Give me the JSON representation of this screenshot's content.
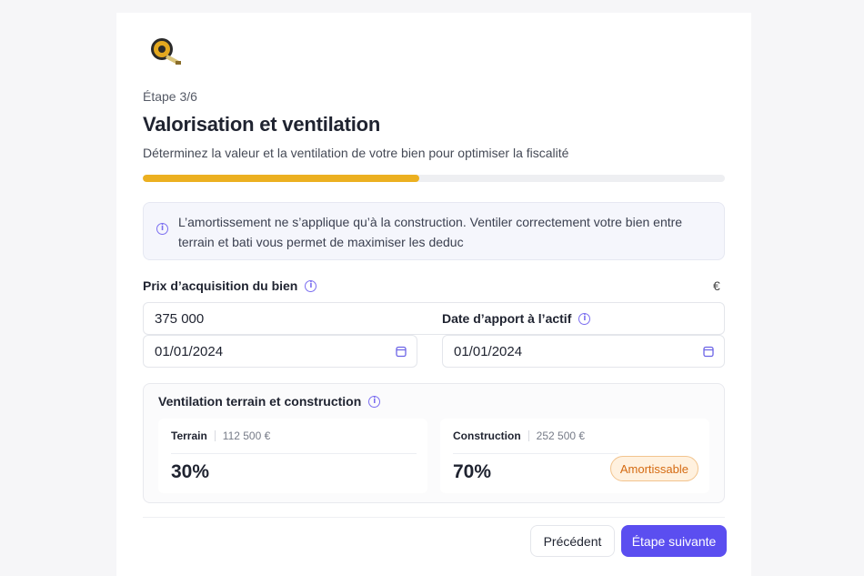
{
  "header": {
    "logo_icon": "tape-measure-icon",
    "step": "Étape 3/6",
    "title": "Valorisation et ventilation",
    "subtitle": "Déterminez la valeur et la ventilation de votre bien pour optimiser la fiscalité"
  },
  "progress": {
    "fraction": 0.475,
    "color": "#ecb020"
  },
  "info": {
    "text": "L’amortissement ne s’applique qu’à la construction. Ventiler correctement votre bien entre terrain et bati vous permet de maximiser les deduc"
  },
  "acquisition": {
    "label": "Prix d’acquisition du bien",
    "currency": "€",
    "price_value": "375 000",
    "date_value": "01/01/2024"
  },
  "apport": {
    "label": "Date d’apport à l’actif",
    "date_value": "01/01/2024"
  },
  "ventilation": {
    "title": "Ventilation terrain et construction",
    "terrain": {
      "name": "Terrain",
      "amount": "112 500 €",
      "percent": "30%"
    },
    "construction": {
      "name": "Construction",
      "amount": "252 500 €",
      "percent": "70%",
      "badge": "Amortissable"
    }
  },
  "actions": {
    "prev_label": "Précédent",
    "next_label": "Étape suivante"
  },
  "colors": {
    "accent": "#5b4ef0",
    "info_icon": "#7b6ef0",
    "badge_text": "#d46a12"
  }
}
